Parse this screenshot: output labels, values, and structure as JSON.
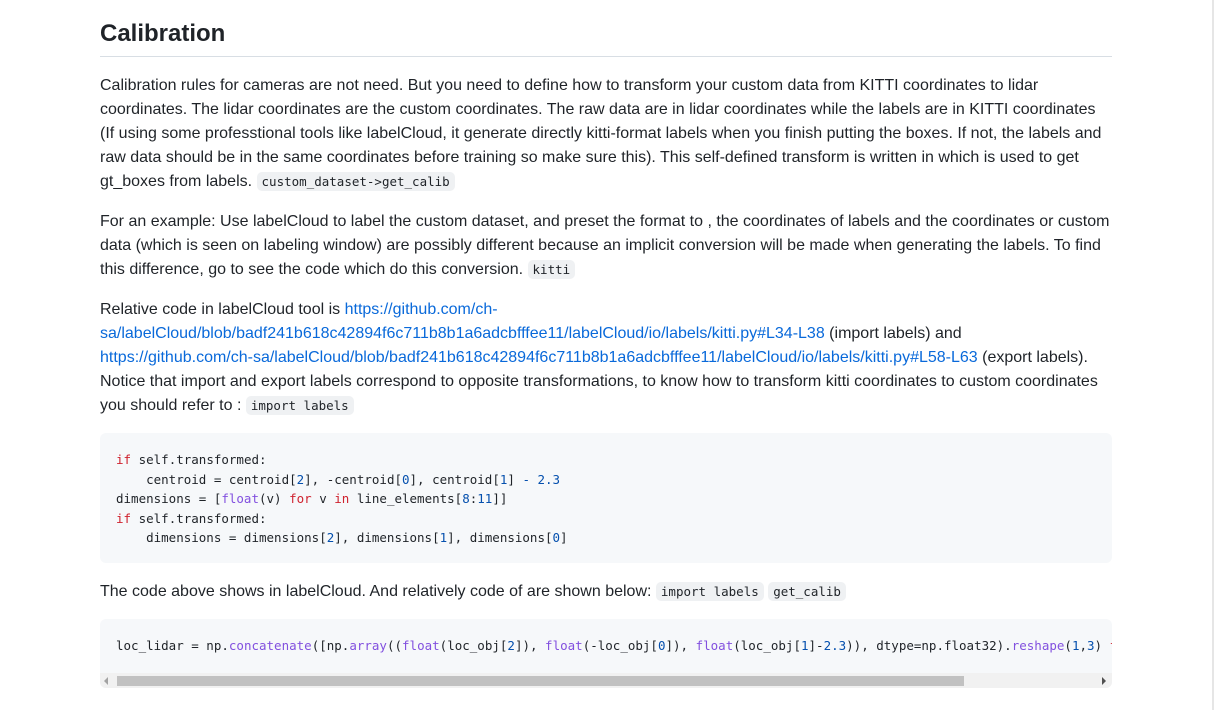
{
  "heading": "Calibration",
  "para1": {
    "text": "Calibration rules for cameras are not need. But you need to define how to transform your custom data from KITTI coordinates to lidar coordinates. The lidar coordinates are the custom coordinates. The raw data are in lidar coordinates while the labels are in KITTI coordinates (If using some professtional tools like labelCloud, it generate directly kitti-format labels when you finish putting the boxes. If not, the labels and raw data should be in the same coordinates before training so make sure this). This self-defined transform is written in which is used to get gt_boxes from labels.",
    "code": "custom_dataset->get_calib"
  },
  "para2": {
    "text": "For an example: Use labelCloud to label the custom dataset, and preset the format to , the coordinates of labels and the coordinates or custom data (which is seen on labeling window) are possibly different because an implicit conversion will be made when generating the labels. To find this difference, go to see the code which do this conversion.",
    "code": "kitti"
  },
  "para3": {
    "prefix": "Relative code in labelCloud tool is ",
    "link1": "https://github.com/ch-sa/labelCloud/blob/badf241b618c42894f6c711b8b1a6adcbfffee11/labelCloud/io/labels/kitti.py#L34-L38",
    "mid": " (import labels) and ",
    "link2": "https://github.com/ch-sa/labelCloud/blob/badf241b618c42894f6c711b8b1a6adcbfffee11/labelCloud/io/labels/kitti.py#L58-L63",
    "suffix": " (export labels). Notice that import and export labels correspond to opposite transformations, to know how to transform kitti coordinates to custom coordinates you should refer to : ",
    "code": "import labels"
  },
  "para4": {
    "text": "The code above shows in labelCloud. And relatively code of are shown below:",
    "code1": "import labels",
    "code2": "get_calib"
  },
  "code_block1": {
    "l1_kw": "if",
    "l1_rest": " self.transformed:",
    "l2_a": "    centroid = centroid[",
    "l2_n1": "2",
    "l2_b": "], -centroid[",
    "l2_n2": "0",
    "l2_c": "], centroid[",
    "l2_n3": "1",
    "l2_d": "] ",
    "l2_op": "-",
    "l2_e": " ",
    "l2_n4": "2.3",
    "l3_a": "dimensions = [",
    "l3_fn": "float",
    "l3_b": "(v) ",
    "l3_kw1": "for",
    "l3_c": " v ",
    "l3_kw2": "in",
    "l3_d": " line_elements[",
    "l3_n1": "8",
    "l3_e": ":",
    "l3_n2": "11",
    "l3_f": "]]",
    "l4_kw": "if",
    "l4_rest": " self.transformed:",
    "l5_a": "    dimensions = dimensions[",
    "l5_n1": "2",
    "l5_b": "], dimensions[",
    "l5_n2": "1",
    "l5_c": "], dimensions[",
    "l5_n3": "0",
    "l5_d": "]"
  },
  "code_block2": {
    "a": "loc_lidar = np.",
    "fn1": "concatenate",
    "b": "([np.",
    "fn2": "array",
    "c": "((",
    "fn3": "float",
    "d": "(loc_obj[",
    "n1": "2",
    "e": "]), ",
    "fn4": "float",
    "f": "(-loc_obj[",
    "n2": "0",
    "g": "]), ",
    "fn5": "float",
    "h": "(loc_obj[",
    "n3": "1",
    "i": "]-",
    "n4": "2.3",
    "j": ")), dtype=np.float32).",
    "fn6": "reshape",
    "k": "(",
    "n5": "1",
    "l": ",",
    "n6": "3",
    "m": ") ",
    "fn7": "fo"
  }
}
